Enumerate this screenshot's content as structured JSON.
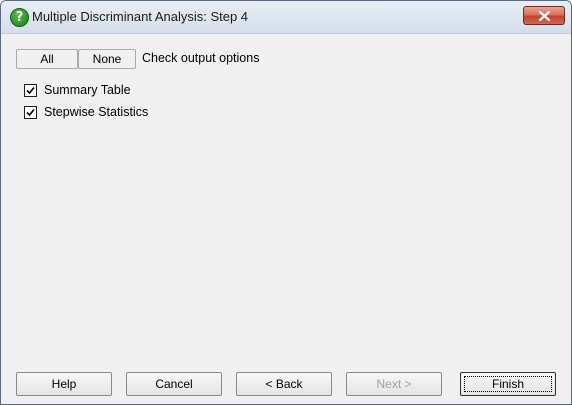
{
  "window": {
    "title": "Multiple Discriminant Analysis: Step 4",
    "title_icon": "?"
  },
  "toolbar": {
    "all_label": "All",
    "none_label": "None",
    "instruction": "Check output options"
  },
  "options": [
    {
      "label": "Summary Table",
      "checked": true
    },
    {
      "label": "Stepwise Statistics",
      "checked": true
    }
  ],
  "footer": {
    "help_label": "Help",
    "cancel_label": "Cancel",
    "back_label": "< Back",
    "next_label": "Next >",
    "finish_label": "Finish"
  }
}
